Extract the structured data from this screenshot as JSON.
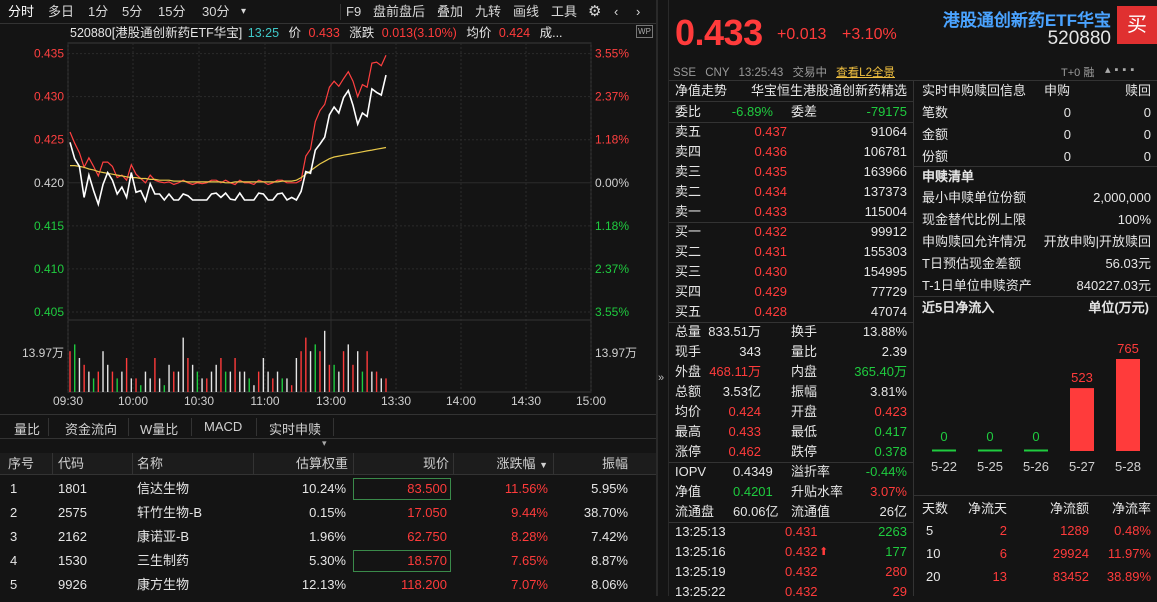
{
  "toolbar": {
    "tabs": [
      "分时",
      "多日",
      "1分",
      "5分",
      "15分",
      "30分"
    ],
    "right": [
      "F9",
      "盘前盘后",
      "叠加",
      "九转",
      "画线",
      "工具"
    ]
  },
  "chart": {
    "info": {
      "code": "520880[港股通创新药ETF华宝]",
      "time": "13:25",
      "price_label": "价",
      "price": "0.433",
      "chg_label": "涨跌",
      "chg": "0.013(3.10%)",
      "avg_label": "均价",
      "avg": "0.424",
      "more": "成..."
    },
    "left_ticks": [
      "0.435",
      "0.430",
      "0.425",
      "0.420",
      "0.415",
      "0.410",
      "0.405"
    ],
    "right_ticks": [
      "3.55%",
      "2.37%",
      "1.18%",
      "0.00%",
      "1.18%",
      "2.37%",
      "3.55%"
    ],
    "vol_left": "13.97万",
    "vol_right": "13.97万",
    "time_ticks": [
      "09:30",
      "10:00",
      "10:30",
      "11:00",
      "13:00",
      "13:30",
      "14:00",
      "14:30",
      "15:00"
    ]
  },
  "chart_data": {
    "type": "line",
    "series": [
      {
        "name": "价",
        "color": "#ffffff",
        "values": [
          0.4247,
          0.4228,
          0.4219,
          0.4183,
          0.4209,
          0.4191,
          0.4175,
          0.4198,
          0.4212,
          0.4203,
          0.4187,
          0.4195,
          0.4183,
          0.4212,
          0.4189,
          0.4191,
          0.4179,
          0.4199,
          0.4187,
          0.4187,
          0.418,
          0.4187,
          0.418,
          0.418,
          0.4187,
          0.4185,
          0.418,
          0.418,
          0.418,
          0.418,
          0.4187,
          0.4188,
          0.4183,
          0.4188,
          0.4181,
          0.418,
          0.4188,
          0.418,
          0.418,
          0.418,
          0.4188,
          0.4187,
          0.418,
          0.418,
          0.4187,
          0.4188,
          0.418,
          0.4183,
          0.418,
          0.419,
          0.4213,
          0.4211,
          0.4238,
          0.4245,
          0.4253,
          0.4279,
          0.4288,
          0.4281,
          0.4299,
          0.4307,
          0.429,
          0.4268,
          0.4281,
          0.4277,
          0.4309,
          0.4305,
          0.4302,
          0.4325
        ]
      },
      {
        "name": "均价",
        "color": "#e8c84a",
        "values": [
          0.422,
          0.422,
          0.4219,
          0.4218,
          0.4216,
          0.4215,
          0.4213,
          0.4212,
          0.4211,
          0.421,
          0.4209,
          0.4208,
          0.4207,
          0.4206,
          0.4206,
          0.4205,
          0.4205,
          0.4204,
          0.4204,
          0.4203,
          0.4203,
          0.4203,
          0.4202,
          0.4202,
          0.4202,
          0.4201,
          0.4201,
          0.4201,
          0.4201,
          0.4201,
          0.4201,
          0.4201,
          0.4201,
          0.42,
          0.42,
          0.4201,
          0.4201,
          0.4201,
          0.4201,
          0.4201,
          0.4201,
          0.4201,
          0.4201,
          0.4201,
          0.4201,
          0.4202,
          0.4202,
          0.4202,
          0.4203,
          0.4206,
          0.421,
          0.4214,
          0.4218,
          0.4222,
          0.4225,
          0.4228,
          0.423,
          0.4231,
          0.4232,
          0.4233,
          0.4234,
          0.4235,
          0.4236,
          0.4237,
          0.4238,
          0.4239,
          0.424,
          0.4241
        ]
      },
      {
        "name": "参考",
        "color": "#ff4040",
        "values": [
          0.4259,
          0.4246,
          0.4235,
          0.4218,
          0.4229,
          0.4219,
          0.4208,
          0.4224,
          0.4224,
          0.4219,
          0.4206,
          0.4209,
          0.4203,
          0.4221,
          0.421,
          0.4205,
          0.42,
          0.4209,
          0.4203,
          0.4201,
          0.42,
          0.4201,
          0.4198,
          0.42,
          0.4203,
          0.42,
          0.4198,
          0.42,
          0.4199,
          0.42,
          0.4203,
          0.4203,
          0.42,
          0.4203,
          0.42,
          0.4198,
          0.4203,
          0.42,
          0.42,
          0.4198,
          0.4203,
          0.4201,
          0.4198,
          0.42,
          0.4203,
          0.4203,
          0.42,
          0.42,
          0.42,
          0.4203,
          0.4231,
          0.4239,
          0.4271,
          0.4284,
          0.4291,
          0.4311,
          0.4318,
          0.4312,
          0.4321,
          0.4329,
          0.4318,
          0.43,
          0.4314,
          0.4311,
          0.4339,
          0.434,
          0.4336,
          0.4348
        ]
      }
    ],
    "ylim": [
      0.405,
      0.436
    ],
    "volumes": [
      0.6,
      0.7,
      0.5,
      0.4,
      0.3,
      0.2,
      0.3,
      0.6,
      0.4,
      0.3,
      0.2,
      0.3,
      0.5,
      0.2,
      0.2,
      0.1,
      0.3,
      0.2,
      0.5,
      0.2,
      0.1,
      0.4,
      0.3,
      0.3,
      0.8,
      0.5,
      0.4,
      0.3,
      0.2,
      0.2,
      0.3,
      0.4,
      0.5,
      0.3,
      0.3,
      0.5,
      0.3,
      0.3,
      0.2,
      0.1,
      0.3,
      0.5,
      0.3,
      0.2,
      0.3,
      0.2,
      0.2,
      0.1,
      0.5,
      0.6,
      0.8,
      0.6,
      0.7,
      0.6,
      0.9,
      0.4,
      0.4,
      0.3,
      0.6,
      0.7,
      0.4,
      0.6,
      0.3,
      0.6,
      0.3,
      0.3,
      0.2,
      0.2
    ],
    "volume_colors": [
      "r",
      "g",
      "w",
      "r",
      "w",
      "g",
      "r",
      "w",
      "w",
      "r",
      "g",
      "w",
      "r",
      "w",
      "r",
      "g",
      "w",
      "w",
      "r",
      "w",
      "g",
      "w",
      "r",
      "w",
      "w",
      "r",
      "w",
      "g",
      "w",
      "r",
      "w",
      "w",
      "r",
      "g",
      "w",
      "r",
      "w",
      "w",
      "g",
      "w",
      "r",
      "w",
      "w",
      "r",
      "w",
      "g",
      "w",
      "r",
      "w",
      "r",
      "r",
      "w",
      "g",
      "r",
      "w",
      "r",
      "g",
      "w",
      "r",
      "w",
      "r",
      "w",
      "g",
      "r",
      "w",
      "r",
      "w",
      "r"
    ]
  },
  "bottom_tabs": [
    "量比",
    "资金流向",
    "W量比",
    "MACD",
    "实时申赎"
  ],
  "table": {
    "headers": [
      "序号",
      "代码",
      "名称",
      "估算权重",
      "现价",
      "涨跌幅",
      "振幅"
    ],
    "rows": [
      [
        "1",
        "1801",
        "信达生物",
        "10.24%",
        "83.500",
        "11.56%",
        "5.95%"
      ],
      [
        "2",
        "2575",
        "轩竹生物-B",
        "0.15%",
        "17.050",
        "9.44%",
        "38.70%"
      ],
      [
        "3",
        "2162",
        "康诺亚-B",
        "1.96%",
        "62.750",
        "8.28%",
        "7.42%"
      ],
      [
        "4",
        "1530",
        "三生制药",
        "5.30%",
        "18.570",
        "7.65%",
        "8.87%"
      ],
      [
        "5",
        "9926",
        "康方生物",
        "12.13%",
        "118.200",
        "7.07%",
        "8.06%"
      ]
    ]
  },
  "quote": {
    "price": "0.433",
    "chg": "+0.013",
    "pct": "+3.10%",
    "name": "港股通创新药ETF华宝",
    "code": "520880",
    "buy": "买",
    "sub": [
      "SSE",
      "CNY",
      "13:25:43",
      "交易中",
      "查看L2全景"
    ],
    "t0": "T+0",
    "rong": "融"
  },
  "ob": {
    "header": [
      "净值走势",
      "华宝恒生港股通创新药精选"
    ],
    "weibi": [
      "委比",
      "-6.89%",
      "委差",
      "-79175"
    ],
    "asks": [
      [
        "卖五",
        "0.437",
        "91064"
      ],
      [
        "卖四",
        "0.436",
        "106781"
      ],
      [
        "卖三",
        "0.435",
        "163966"
      ],
      [
        "卖二",
        "0.434",
        "137373"
      ],
      [
        "卖一",
        "0.433",
        "115004"
      ]
    ],
    "bids": [
      [
        "买一",
        "0.432",
        "99912"
      ],
      [
        "买二",
        "0.431",
        "155303"
      ],
      [
        "买三",
        "0.430",
        "154995"
      ],
      [
        "买四",
        "0.429",
        "77729"
      ],
      [
        "买五",
        "0.428",
        "47074"
      ]
    ],
    "stats": [
      [
        "总量",
        "833.51万",
        "换手",
        "13.88%"
      ],
      [
        "现手",
        "343",
        "量比",
        "2.39"
      ],
      [
        "外盘",
        "468.11万",
        "内盘",
        "365.40万"
      ],
      [
        "总额",
        "3.53亿",
        "振幅",
        "3.81%"
      ],
      [
        "均价",
        "0.424",
        "开盘",
        "0.423"
      ],
      [
        "最高",
        "0.433",
        "最低",
        "0.417"
      ],
      [
        "涨停",
        "0.462",
        "跌停",
        "0.378"
      ]
    ],
    "iopv": [
      [
        "IOPV",
        "0.4349",
        "溢折率",
        "-0.44%"
      ],
      [
        "净值",
        "0.4201",
        "升贴水率",
        "3.07%"
      ],
      [
        "流通盘",
        "60.06亿",
        "流通值",
        "26亿"
      ]
    ],
    "ticks": [
      [
        "13:25:13",
        "0.431",
        "2263"
      ],
      [
        "13:25:16",
        "0.432",
        "177"
      ],
      [
        "13:25:19",
        "0.432",
        "280"
      ],
      [
        "13:25:22",
        "0.432",
        "29"
      ]
    ]
  },
  "sub": {
    "title": "实时申购赎回信息",
    "cols": [
      "申购",
      "赎回"
    ],
    "rows": [
      [
        "笔数",
        "0",
        "0"
      ],
      [
        "金额",
        "0",
        "0"
      ],
      [
        "份额",
        "0",
        "0"
      ]
    ],
    "list_title": "申赎清单",
    "list": [
      [
        "最小申赎单位份额",
        "2,000,000"
      ],
      [
        "现金替代比例上限",
        "100%"
      ],
      [
        "申购赎回允许情况",
        "开放申购|开放赎回"
      ],
      [
        "T日预估现金差额",
        "56.03元"
      ],
      [
        "T-1日单位申赎资产",
        "840227.03元"
      ]
    ],
    "flow_title": "近5日净流入",
    "flow_unit": "单位(万元)",
    "flow_dates": [
      "5-22",
      "5-25",
      "5-26",
      "5-27",
      "5-28"
    ],
    "flow_values": [
      0,
      0,
      0,
      523,
      765
    ],
    "ft_headers": [
      "天数",
      "净流天",
      "净流额",
      "净流率"
    ],
    "ft_rows": [
      [
        "5",
        "2",
        "1289",
        "0.48%"
      ],
      [
        "10",
        "6",
        "29924",
        "11.97%"
      ],
      [
        "20",
        "13",
        "83452",
        "38.89%"
      ]
    ]
  }
}
